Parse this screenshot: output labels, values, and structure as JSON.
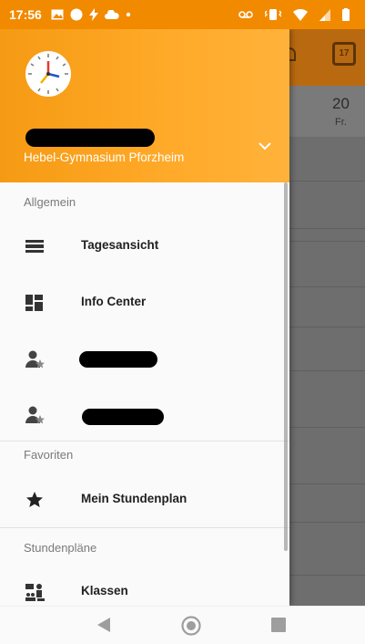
{
  "status_bar": {
    "time": "17:56",
    "left_icons": [
      "gallery-icon",
      "circle-notification-icon",
      "flash-icon",
      "cloud-icon",
      "dot-icon"
    ],
    "right_icons": [
      "voicemail-icon",
      "vibrate-icon",
      "wifi-icon",
      "signal-icon",
      "battery-icon"
    ]
  },
  "drawer": {
    "header": {
      "logo_icon": "clock-icon",
      "account_name": "",
      "school": "Hebel-Gymnasium Pforzheim",
      "toggle_icon": "chevron-down-icon"
    },
    "sections": [
      {
        "title": "Allgemein",
        "items": [
          {
            "label": "Tagesansicht",
            "icon": "day-view-icon"
          },
          {
            "label": "Info Center",
            "icon": "dashboard-icon"
          },
          {
            "label": "",
            "icon": "teacher-star-icon"
          },
          {
            "label": "",
            "icon": "teacher-star-icon"
          }
        ]
      },
      {
        "title": "Favoriten",
        "items": [
          {
            "label": "Mein Stundenplan",
            "icon": "star-icon"
          }
        ]
      },
      {
        "title": "Stundenpläne",
        "items": [
          {
            "label": "Klassen",
            "icon": "classes-icon"
          }
        ]
      }
    ]
  },
  "background_app": {
    "calendar_icon_date": "17",
    "day_number": "20",
    "day_name": "Fr."
  },
  "nav_bar": {
    "icons": [
      "back-icon",
      "home-icon",
      "recents-icon"
    ]
  },
  "colors": {
    "accent": "#f28a00",
    "header_gradient_start": "#f59a13",
    "header_gradient_end": "#ffb23a",
    "overlay": "#6e6e6e"
  }
}
